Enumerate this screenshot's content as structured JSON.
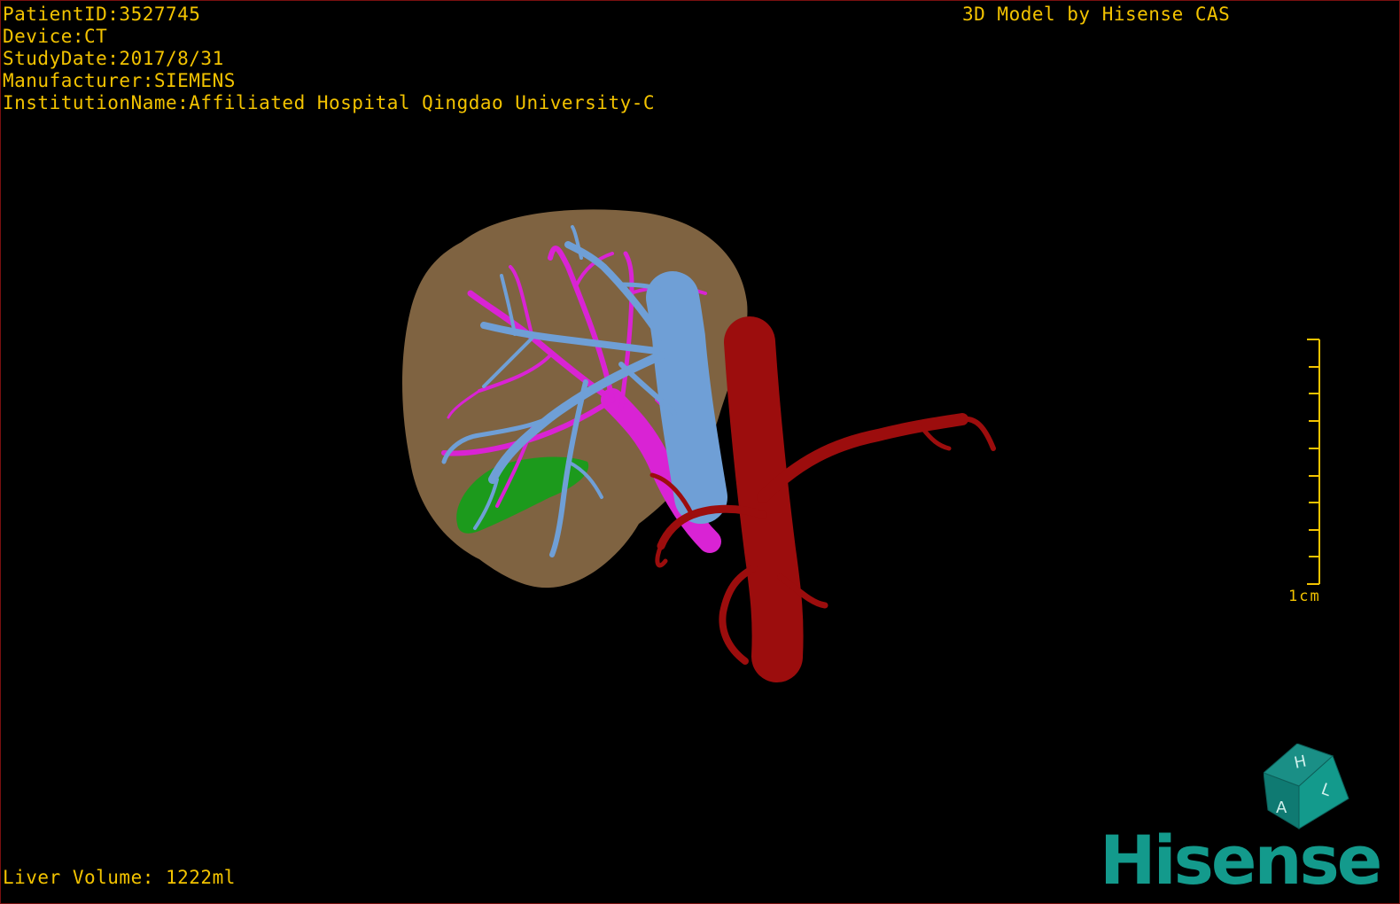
{
  "patient_info": {
    "patient_id": "PatientID:3527745",
    "device": "Device:CT",
    "study_date": "StudyDate:2017/8/31",
    "manufacturer": "Manufacturer:SIEMENS",
    "institution": "InstitutionName:Affiliated Hospital Qingdao University-C"
  },
  "credit": "3D Model by Hisense CAS",
  "liver_volume": "Liver Volume: 1222ml",
  "scale_bar": {
    "label": "1cm",
    "ticks": 9
  },
  "orientation_cube": {
    "face_top": "H",
    "face_left": "A",
    "face_right": "L",
    "icon": "orientation-cube-icon"
  },
  "logo": {
    "text": "Hisense",
    "color": "#139a8c"
  },
  "colors": {
    "text": "#f3c300",
    "liver": "#8a6b46",
    "hepatic_vein": "#6f9fd6",
    "portal_vein": "#d923d4",
    "artery": "#9c0d0d",
    "gallbladder": "#1c9a1c",
    "frame": "#7a1010"
  }
}
